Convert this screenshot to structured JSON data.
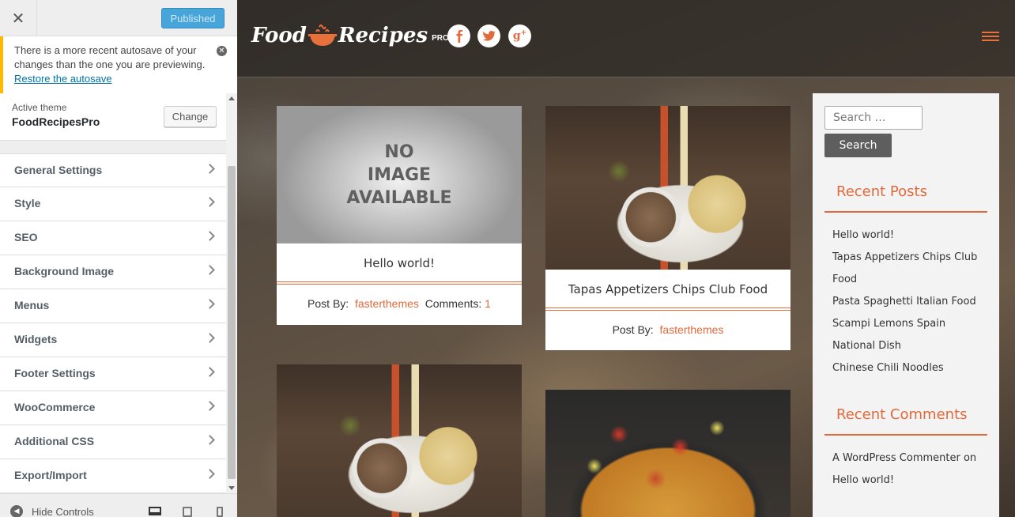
{
  "customizer": {
    "close_label": "✕",
    "publish_label": "Published",
    "notice": {
      "text": "There is a more recent autosave of your changes than the one you are previewing.",
      "link": "Restore the autosave"
    },
    "theme": {
      "label": "Active theme",
      "name": "FoodRecipesPro",
      "change_label": "Change"
    },
    "sections": [
      "General Settings",
      "Style",
      "SEO",
      "Background Image",
      "Menus",
      "Widgets",
      "Footer Settings",
      "WooCommerce",
      "Additional CSS",
      "Export/Import"
    ],
    "footer": {
      "hide_label": "Hide Controls"
    }
  },
  "site": {
    "logo": {
      "word1": "Food",
      "word2": "Recipes",
      "badge": "PRO"
    },
    "social": [
      "facebook-icon",
      "twitter-icon",
      "google-plus-icon"
    ],
    "accent_color": "#e06a3b",
    "posts": [
      {
        "title": "Hello world!",
        "image_placeholder": [
          "NO",
          "IMAGE",
          "AVAILABLE"
        ],
        "post_by_label": "Post By:",
        "author": "fasterthemes",
        "comments_label": "Comments:",
        "comments": "1"
      },
      {
        "title": "Tapas Appetizers Chips Club Food",
        "post_by_label": "Post By:",
        "author": "fasterthemes"
      }
    ],
    "sidebar": {
      "search_placeholder": "Search …",
      "search_button": "Search",
      "recent_posts_title": "Recent Posts",
      "recent_posts": [
        "Hello world!",
        "Tapas Appetizers Chips Club Food",
        "Pasta Spaghetti Italian Food",
        "Scampi Lemons Spain",
        "National Dish",
        "Chinese Chili Noodles"
      ],
      "recent_comments_title": "Recent Comments",
      "recent_comment_author": "A WordPress Commenter",
      "recent_comment_on": "on",
      "recent_comment_post": "Hello world!"
    }
  }
}
